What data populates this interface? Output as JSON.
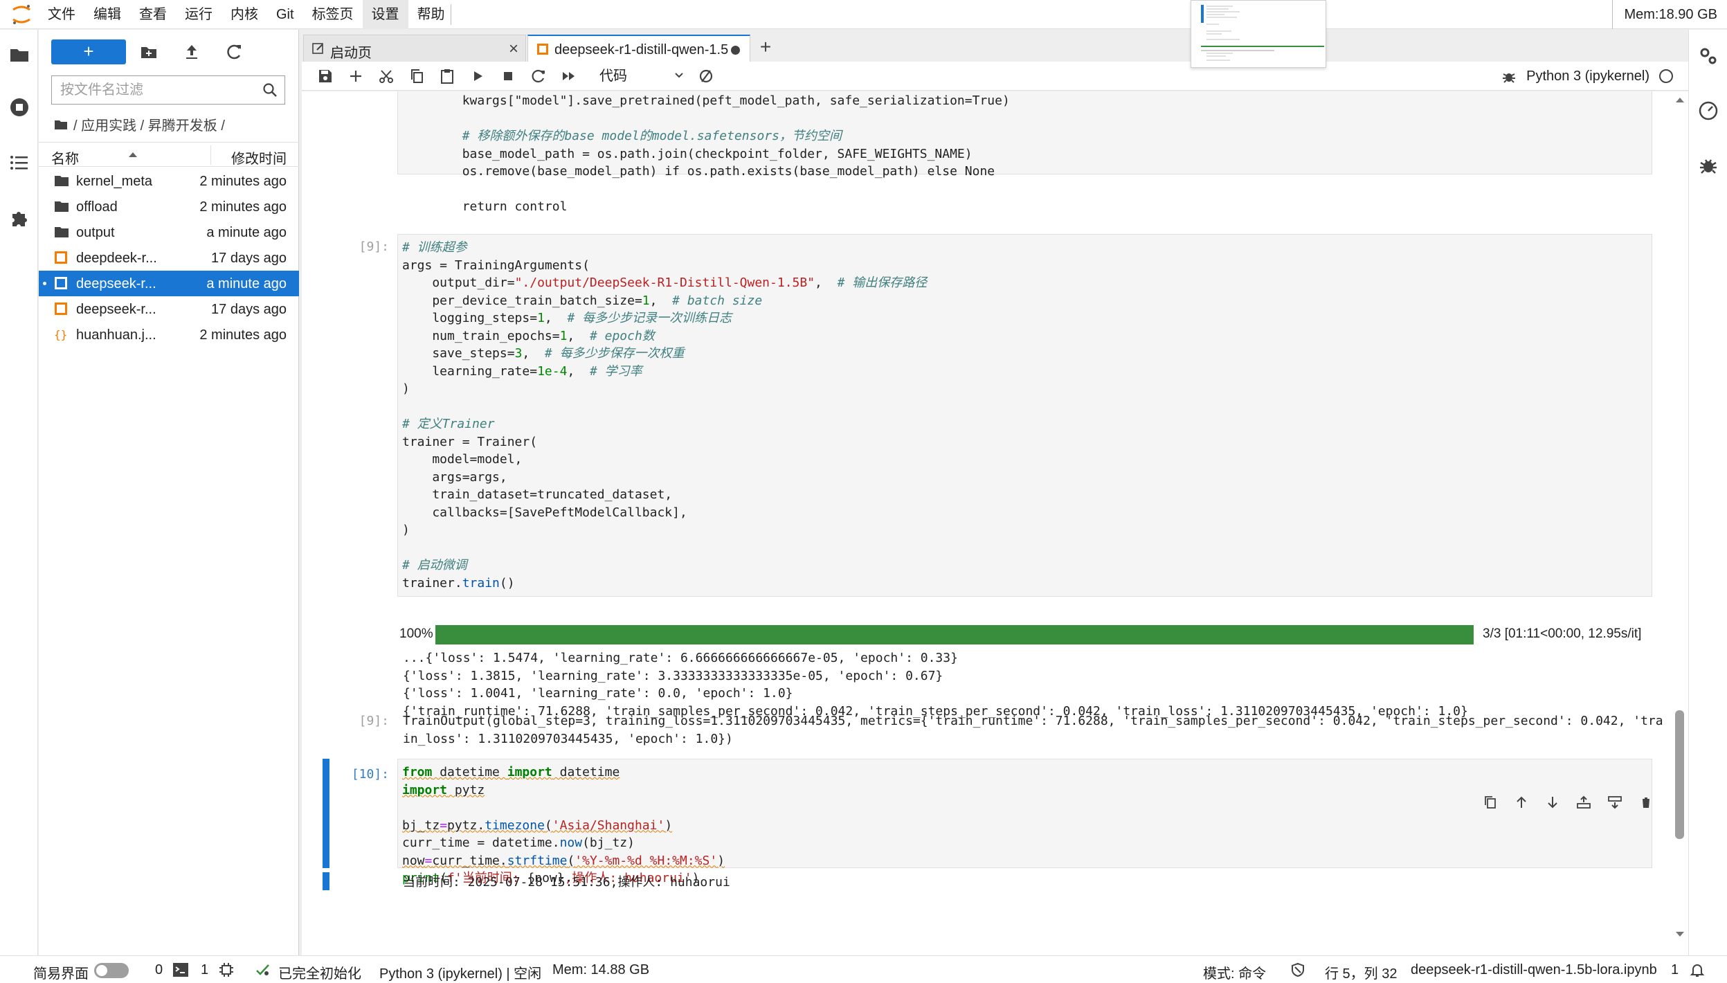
{
  "menubar": {
    "items": [
      "文件",
      "编辑",
      "查看",
      "运行",
      "内核",
      "Git",
      "标签页",
      "设置",
      "帮助"
    ],
    "active_index": 7,
    "mem": "Mem:18.90 GB"
  },
  "filebrowser": {
    "filter_placeholder": "按文件名过滤",
    "breadcrumb": "/ 应用实践 / 昇腾开发板 /",
    "col_name": "名称",
    "col_modified": "修改时间",
    "rows": [
      {
        "name": "kernel_meta",
        "modified": "2 minutes ago",
        "type": "folder",
        "selected": false
      },
      {
        "name": "offload",
        "modified": "2 minutes ago",
        "type": "folder",
        "selected": false
      },
      {
        "name": "output",
        "modified": "a minute ago",
        "type": "folder",
        "selected": false
      },
      {
        "name": "deepdeek-r...",
        "modified": "17 days ago",
        "type": "notebook",
        "selected": false
      },
      {
        "name": "deepseek-r...",
        "modified": "a minute ago",
        "type": "notebook",
        "selected": true
      },
      {
        "name": "deepseek-r...",
        "modified": "17 days ago",
        "type": "notebook",
        "selected": false
      },
      {
        "name": "huanhuan.j...",
        "modified": "2 minutes ago",
        "type": "json",
        "selected": false
      }
    ]
  },
  "tabs": [
    {
      "label": "启动页",
      "active": false
    },
    {
      "label": "deepseek-r1-distill-qwen-1.5",
      "active": true
    }
  ],
  "toolbar": {
    "cell_type": "代码",
    "kernel": "Python 3 (ipykernel)"
  },
  "cells": {
    "c8_lines": [
      "        kwargs[\"model\"].save_pretrained(peft_model_path, safe_serialization=True)",
      "",
      "        # 移除额外保存的base model的model.safetensors，节约空间",
      "        base_model_path = os.path.join(checkpoint_folder, SAFE_WEIGHTS_NAME)",
      "        os.remove(base_model_path) if os.path.exists(base_model_path) else None",
      "",
      "        return control"
    ],
    "c9_prompt": "[9]:",
    "c9_out_prompt": "[9]:",
    "progress": {
      "percent_label": "100%",
      "value": 1.0,
      "info": "3/3  [01:11<00:00,  12.95s/it]"
    },
    "c9_stdout": [
      "...{'loss': 1.5474, 'learning_rate': 6.666666666666667e-05, 'epoch': 0.33}",
      "{'loss': 1.3815, 'learning_rate': 3.3333333333333335e-05, 'epoch': 0.67}",
      "{'loss': 1.0041, 'learning_rate': 0.0, 'epoch': 1.0}",
      "{'train_runtime': 71.6288, 'train_samples_per_second': 0.042, 'train_steps_per_second': 0.042, 'train_loss': 1.3110209703445435, 'epoch': 1.0}"
    ],
    "c9_result": [
      "TrainOutput(global_step=3, training_loss=1.3110209703445435, metrics={'train_runtime': 71.6288, 'train_samples_per_second': 0.042, 'train_steps_per_second': 0.042, 'tra",
      "in_loss': 1.3110209703445435, 'epoch': 1.0})"
    ],
    "c10_prompt": "[10]:",
    "c10_output": "当前时间: 2025-07-28 15:51:36,操作人: huhaorui"
  },
  "statusbar": {
    "simple_mode": "简易界面",
    "terminals": "0",
    "kernels": "1",
    "init": "已完全初始化",
    "kernel_status": "Python 3 (ipykernel) | 空闲",
    "mem": "Mem: 14.88 GB",
    "mode": "模式: 命令",
    "position": "行 5，列 32",
    "filename": "deepseek-r1-distill-qwen-1.5b-lora.ipynb",
    "notifications": "1"
  },
  "colors": {
    "accent": "#1976d2",
    "progress": "#388e3c",
    "notebook_icon": "#f57c00"
  }
}
